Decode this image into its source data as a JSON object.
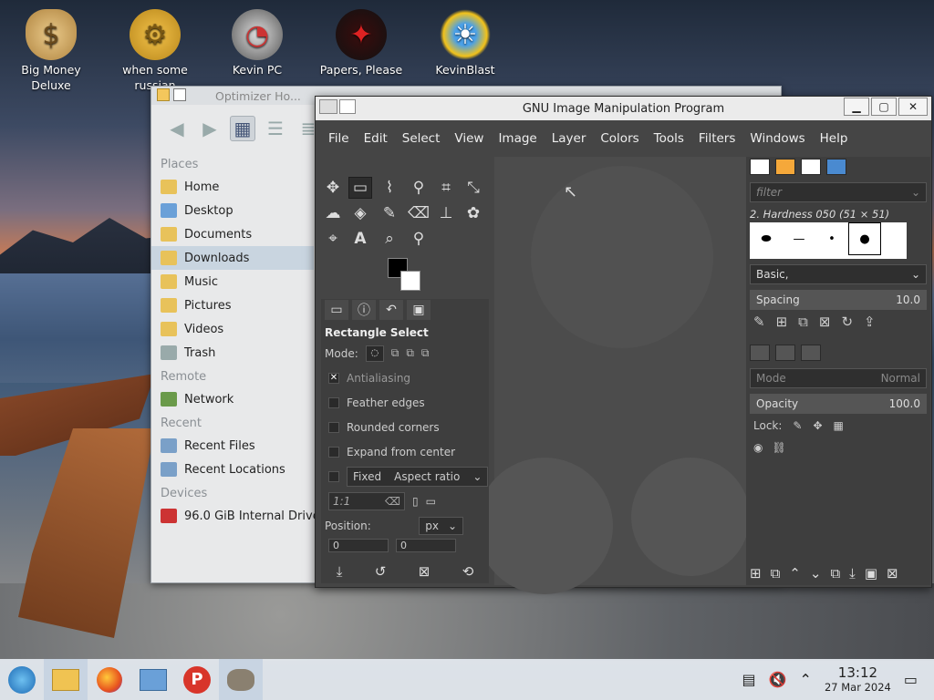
{
  "desktop": {
    "icons": [
      {
        "label": "Big Money\nDeluxe",
        "icon": "money-bag-icon"
      },
      {
        "label": "when some\nrussian",
        "icon": "gear-icon"
      },
      {
        "label": "Kevin PC",
        "icon": "gauge-icon"
      },
      {
        "label": "Papers, Please",
        "icon": "papers-please-icon"
      },
      {
        "label": "KevinBlast",
        "icon": "blast-icon"
      }
    ]
  },
  "file_manager": {
    "title": "Optimizer Ho...",
    "sections": {
      "places": "Places",
      "remote": "Remote",
      "recent": "Recent",
      "devices": "Devices"
    },
    "places": [
      "Home",
      "Desktop",
      "Documents",
      "Downloads",
      "Music",
      "Pictures",
      "Videos",
      "Trash"
    ],
    "remote": [
      "Network"
    ],
    "recent": [
      "Recent Files",
      "Recent Locations"
    ],
    "devices": [
      "96.0 GiB Internal Drive"
    ]
  },
  "gimp": {
    "title": "GNU Image Manipulation Program",
    "menu": [
      "File",
      "Edit",
      "Select",
      "View",
      "Image",
      "Layer",
      "Colors",
      "Tools",
      "Filters",
      "Windows",
      "Help"
    ],
    "tool_options": {
      "heading": "Rectangle Select",
      "mode_label": "Mode:",
      "antialiasing": "Antialiasing",
      "feather": "Feather edges",
      "rounded": "Rounded corners",
      "expand": "Expand from center",
      "fixed": "Fixed",
      "aspect": "Aspect ratio",
      "ratio_value": "1:1",
      "position_label": "Position:",
      "position_unit": "px",
      "pos_x": "0",
      "pos_y": "0"
    },
    "brushes": {
      "filter_placeholder": "filter",
      "brush_name": "2. Hardness 050 (51 × 51)",
      "preset": "Basic,",
      "spacing_label": "Spacing",
      "spacing_value": "10.0"
    },
    "layers": {
      "mode_label": "Mode",
      "mode_value": "Normal",
      "opacity_label": "Opacity",
      "opacity_value": "100.0",
      "lock_label": "Lock:"
    }
  },
  "taskbar": {
    "time": "13:12",
    "date": "27 Mar 2024"
  }
}
